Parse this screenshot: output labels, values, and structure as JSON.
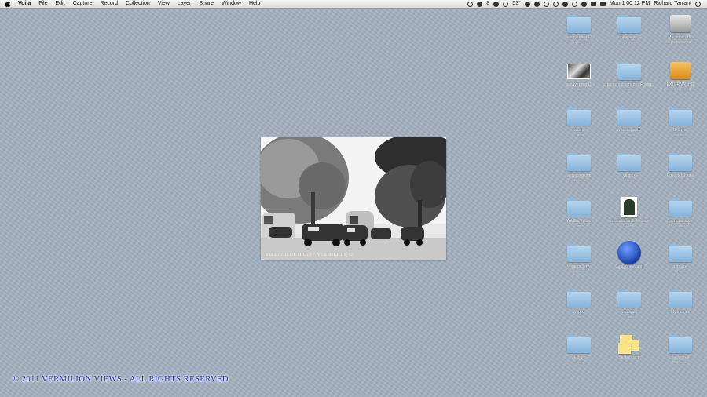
{
  "menubar": {
    "app_name": "Voila",
    "menus": [
      "File",
      "Edit",
      "Capture",
      "Record",
      "Collection",
      "View",
      "Layer",
      "Share",
      "Window",
      "Help"
    ],
    "status": {
      "temperature": "53°",
      "battery_count": "8",
      "clock": "Mon 1 00 12 PM",
      "user": "Richard Tarrant"
    }
  },
  "desktop_icons": [
    {
      "label": "vaadvertiser17",
      "sub": "14 items",
      "kind": "folder"
    },
    {
      "label": "newviews",
      "sub": "24 items",
      "kind": "folder"
    },
    {
      "label": "Macintosh HD",
      "sub": "999.00 GB, 157 GB free",
      "kind": "drive"
    },
    {
      "label": "vaadvertiser16",
      "sub": "2 items",
      "kind": "image"
    },
    {
      "label": "preservationpages Folder",
      "sub": "6 items",
      "kind": "folder"
    },
    {
      "label": "EXTERNAL HD",
      "sub": "1000 GB, 64.43 GB free",
      "kind": "drive-orange"
    },
    {
      "label": "vaaspix",
      "sub": "7 items",
      "kind": "folder"
    },
    {
      "label": "vacationspix",
      "sub": "32 items",
      "kind": "folder"
    },
    {
      "label": "Bitcover",
      "sub": "105 items",
      "kind": "folder"
    },
    {
      "label": "viewscrossing",
      "sub": "274 items",
      "kind": "folder"
    },
    {
      "label": "vingpix",
      "sub": "8 items",
      "kind": "folder"
    },
    {
      "label": "Collected Items",
      "sub": "0 items",
      "kind": "folder"
    },
    {
      "label": "Wildlife Folder",
      "sub": "7 items",
      "kind": "folder"
    },
    {
      "label": "richardtarrantlinkedingr",
      "sub": "445 KB",
      "kind": "doc"
    },
    {
      "label": "garmaalnotes",
      "sub": "3 items",
      "kind": "folder"
    },
    {
      "label": "vanegallery",
      "sub": "40 items",
      "kind": "folder"
    },
    {
      "label": "SeaMonkey.app",
      "sub": "",
      "kind": "seamonkey"
    },
    {
      "label": "nifpalix",
      "sub": "18 items",
      "kind": "folder"
    },
    {
      "label": "vvpix",
      "sub": "20 items",
      "kind": "folder"
    },
    {
      "label": "vvadquilt",
      "sub": "7 items",
      "kind": "folder"
    },
    {
      "label": "My images",
      "sub": "",
      "kind": "folder"
    },
    {
      "label": "wekljons",
      "sub": "7 items",
      "kind": "folder"
    },
    {
      "label": "Stickies.app",
      "sub": "",
      "kind": "stickies"
    },
    {
      "label": "newstoreit",
      "sub": "52 items",
      "kind": "folder"
    }
  ],
  "photo": {
    "caption": "VILLAGE OF OAKS • VERMILION, O"
  },
  "footer": {
    "copyright": "© 2011 VERMILION VIEWS - ALL RIGHTS RESERVED"
  },
  "colors": {
    "desktop": "#a4b2c0",
    "folder": "#9cc4e6",
    "copyright_text": "#1f33b8"
  }
}
